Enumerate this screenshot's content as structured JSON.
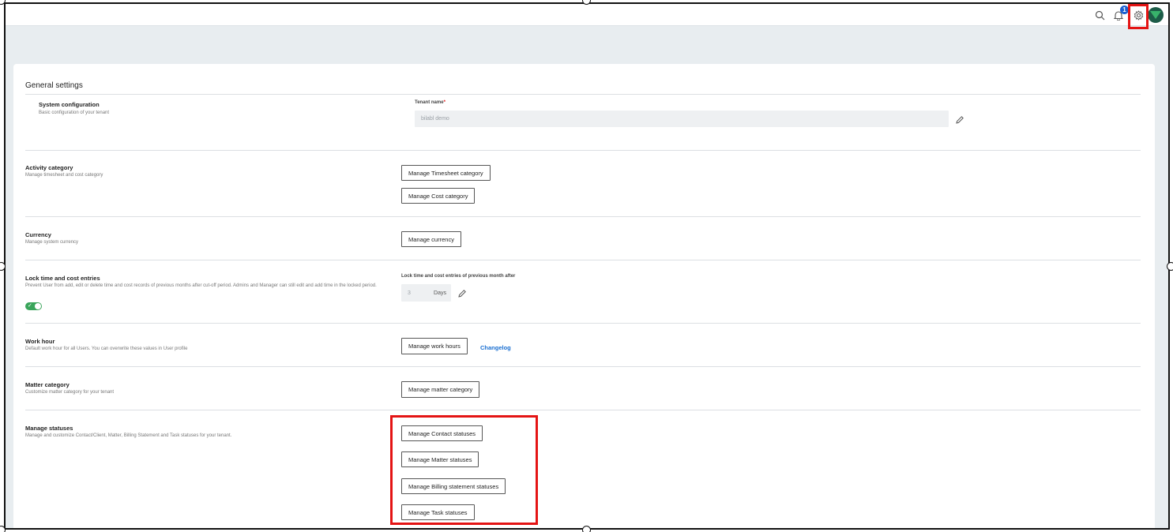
{
  "topbar": {
    "search_icon": "search-icon",
    "notification_icon": "bell-icon",
    "notification_count": "1",
    "settings_icon": "gear-icon",
    "avatar": "user-avatar"
  },
  "card": {
    "title": "General settings"
  },
  "sections": {
    "system": {
      "title": "System configuration",
      "desc": "Basic configuration of your tenant",
      "field_label": "Tenant name",
      "required_mark": "*",
      "field_value": "bilabl demo"
    },
    "activity": {
      "title": "Activity category",
      "desc": "Manage timesheet and cost category",
      "btn_timesheet": "Manage Timesheet category",
      "btn_cost": "Manage Cost category"
    },
    "currency": {
      "title": "Currency",
      "desc": "Manage system currency",
      "btn": "Manage currency"
    },
    "lock": {
      "title": "Lock time and cost entries",
      "desc": "Prevent User from add, edit or delete time and cost records of previous months after cut-off period. Admins and Manager can still edit and add time in the locked period.",
      "toggle_on": true,
      "field_label": "Lock time and cost entries of previous month after",
      "value": "3",
      "unit": "Days"
    },
    "workhour": {
      "title": "Work hour",
      "desc": "Default work hour for all Users. You can overwrite these values in User profile",
      "btn": "Manage work hours",
      "link": "Changelog"
    },
    "matter": {
      "title": "Matter category",
      "desc": "Customize matter category for your tenant",
      "btn": "Manage matter category"
    },
    "statuses": {
      "title": "Manage statuses",
      "desc": "Manage and customize Contact/Client, Matter, Billing Statement and Task statuses for your tenant.",
      "btn_contact": "Manage Contact statuses",
      "btn_matter": "Manage Matter statuses",
      "btn_billing": "Manage Billing statement statuses",
      "btn_task": "Manage Task statuses"
    }
  },
  "colors": {
    "accent_link": "#1a6fd1",
    "toggle_on": "#3aa55b",
    "highlight": "#e41414"
  }
}
